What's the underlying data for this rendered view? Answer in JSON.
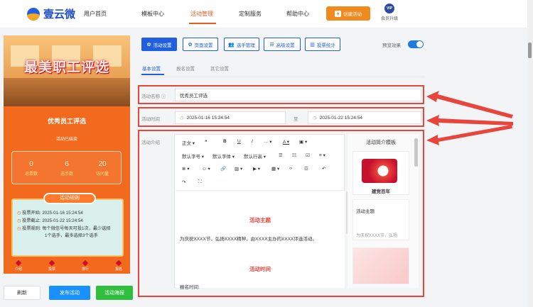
{
  "nav": {
    "brand": "壹云微",
    "items": [
      "用户首页",
      "模板中心",
      "活动管理",
      "定制服务",
      "帮助中心"
    ],
    "create_label": "创建活动",
    "vip_badge": "VIP",
    "vip_label": "会员升级"
  },
  "preview": {
    "poster_title": "最美职工评选",
    "event_name": "优秀员工评选",
    "status": "活动已结束",
    "stats": [
      {
        "value": "0",
        "label": "总票数"
      },
      {
        "value": "6",
        "label": "选手数"
      },
      {
        "value": "20",
        "label": "访问量"
      }
    ],
    "rules_title": "活动规则",
    "rules": [
      "投票开始: 2025-01-16 15:24:54",
      "投票截止: 2025-01-22 15:24:54",
      "投票规则: 每个微信号每天可投1次，最少选择",
      "1个选手，最多选择3个选手"
    ],
    "bottom_nav": [
      "介绍",
      "投票",
      "排行",
      "报名"
    ]
  },
  "actions": {
    "refresh": "刷新",
    "publish": "发布活动",
    "poster": "活动海报"
  },
  "toolbar": {
    "buttons": [
      "活动设置",
      "页面设置",
      "选手管理",
      "高级设置",
      "投票统计"
    ],
    "preview_effect": "预览效果"
  },
  "subtabs": [
    "基本设置",
    "报名设置",
    "其它设置"
  ],
  "form": {
    "name_label": "活动名称",
    "name_value": "优秀员工评选",
    "time_label": "活动时间",
    "start_time": "2025-01-16 15:24:54",
    "time_sep": "至",
    "end_time": "2025-01-22 15:24:54",
    "intro_label": "活动介绍"
  },
  "editor": {
    "toolbar_row1": [
      "正文",
      "❝",
      "B",
      "U",
      "I",
      "···",
      "A",
      "▣"
    ],
    "toolbar_row2": [
      "默认字号",
      "默认字体",
      "默认行高",
      "☰",
      "☷",
      "☑",
      "≡"
    ],
    "toolbar_row3": [
      "≣",
      "☺",
      "🔗",
      "▨",
      "▶",
      "▦",
      "‹›",
      "☲",
      "↶"
    ],
    "toolbar_row4": [
      "↷",
      "⛶"
    ],
    "heading1": "活动主题",
    "paragraph1": "为庆祝XXXX节，弘扬XXXX精神，由XXXX主办的XXXX评选活动。",
    "heading2": "活动时间",
    "paragraph2": "报名时间:"
  },
  "templates": {
    "title": "活动简介模板",
    "card1_text": "建党百年",
    "card2_title": "活动主题",
    "card2_text": "为庆祝XXXX节，弘扬"
  },
  "colors": {
    "accent_orange": "#f08a1c",
    "primary_blue": "#1f5fe0",
    "highlight_red": "#e8453c",
    "poster_orange": "#f36a1e"
  }
}
